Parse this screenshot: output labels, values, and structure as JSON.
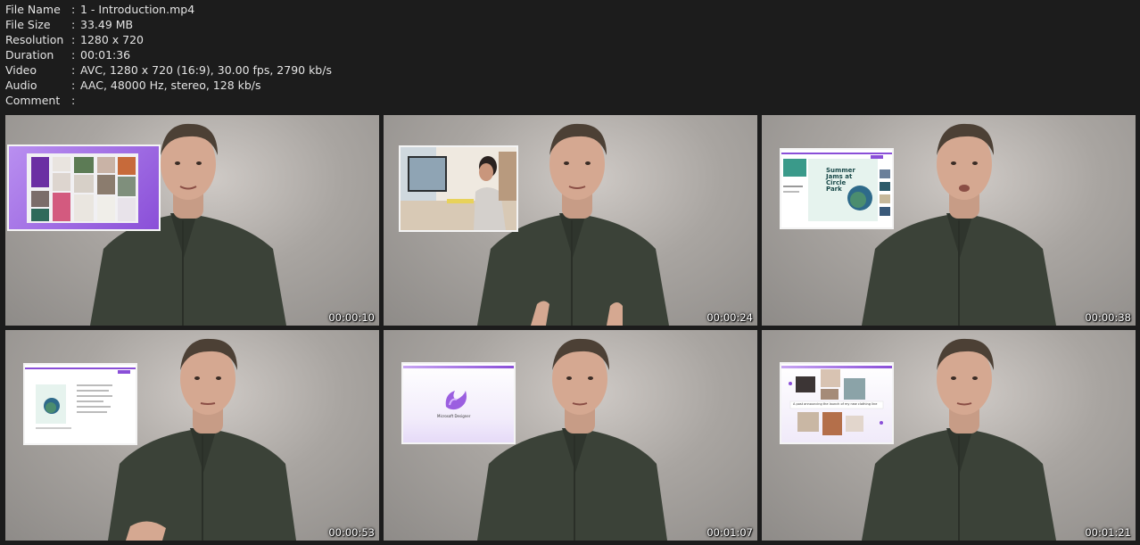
{
  "file_info": [
    {
      "key": "File Name",
      "value": "1 - Introduction.mp4"
    },
    {
      "key": "File Size",
      "value": "33.49 MB"
    },
    {
      "key": "Resolution",
      "value": "1280 x 720"
    },
    {
      "key": "Duration",
      "value": "00:01:36"
    },
    {
      "key": "Video",
      "value": "AVC, 1280 x 720 (16:9), 30.00 fps, 2790 kb/s"
    },
    {
      "key": "Audio",
      "value": "AAC, 48000 Hz, stereo, 128 kb/s"
    },
    {
      "key": "Comment",
      "value": ""
    }
  ],
  "separator": ":",
  "thumbnails": [
    {
      "timestamp": "00:00:10"
    },
    {
      "timestamp": "00:00:24"
    },
    {
      "timestamp": "00:00:38"
    },
    {
      "timestamp": "00:00:53"
    },
    {
      "timestamp": "00:01:07"
    },
    {
      "timestamp": "00:01:21"
    }
  ],
  "insets": {
    "summer_title_lines": [
      "Summer",
      "Jams at",
      "Circle",
      "Park"
    ],
    "logo_caption": "Microsoft Designer",
    "carousel_caption": "A post announcing the launch of my new clothing line"
  },
  "colors": {
    "background": "#1c1c1c",
    "text": "#e4e4e4",
    "accent_purple": "#8a4fd8"
  }
}
